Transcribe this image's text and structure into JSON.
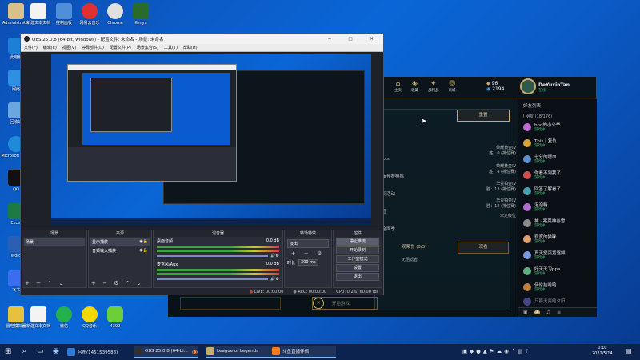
{
  "desktop": {
    "icons_left": [
      {
        "label": "Administrator",
        "color": "#d9c08a"
      },
      {
        "label": "此电脑",
        "color": "#1d7fd6"
      },
      {
        "label": "网络",
        "color": "#2f8fe0"
      },
      {
        "label": "回收站",
        "color": "#6aa6e0"
      },
      {
        "label": "Microsoft Edge",
        "color": "#1e8ad8"
      },
      {
        "label": "QQ",
        "color": "#111111"
      },
      {
        "label": "Excel",
        "color": "#1e7a45"
      },
      {
        "label": "Word",
        "color": "#2a5fb4"
      },
      {
        "label": "飞书",
        "color": "#3a6df0"
      },
      {
        "label": "雷电模拟器",
        "color": "#e8c040"
      }
    ],
    "icons_top": [
      {
        "label": "新建文本文档",
        "color": "#f3f3f3"
      },
      {
        "label": "控制面板",
        "color": "#4f8ed8"
      },
      {
        "label": "网易云音乐",
        "color": "#e03030"
      },
      {
        "label": "Chrome",
        "color": "#e0e0e0"
      },
      {
        "label": "Kenya",
        "color": "#2a6a2a"
      }
    ],
    "icons_bottom": [
      {
        "label": "新建文本文档",
        "color": "#f3f3f3"
      },
      {
        "label": "微信",
        "color": "#23b14d"
      },
      {
        "label": "QQ音乐",
        "color": "#f5d800"
      },
      {
        "label": "4399",
        "color": "#6ccf3a"
      }
    ]
  },
  "taskbar": {
    "apps": [
      {
        "label": "吕布(1451539583)",
        "color": "#2f7bd8"
      },
      {
        "label": "OBS 25.0.8 (64-bi...",
        "color": "#303030"
      },
      {
        "label": "League of Legends",
        "color": "#c8aa6e"
      },
      {
        "label": "斗鱼直播伴侣",
        "color": "#f57a1a"
      }
    ],
    "time": "0:10",
    "date": "2022/5/14"
  },
  "obs": {
    "title": "OBS 25.0.8 (64-bit, windows) - 配置文件: 未命名 - 场景: 未命名",
    "menu": [
      "文件(F)",
      "编辑(E)",
      "视图(V)",
      "停靠部件(D)",
      "配置文件(P)",
      "场景集合(S)",
      "工具(T)",
      "帮助(H)"
    ],
    "docks": {
      "scenes": "场景",
      "sources": "来源",
      "mixer": "混音器",
      "transitions": "转场特效",
      "controls": "控件"
    },
    "scene_item": "场景",
    "sources": [
      "显示捕获",
      "音频输入捕获"
    ],
    "mixer": [
      {
        "name": "桌面音频",
        "db": "0.0 dB"
      },
      {
        "name": "麦克风/Aux",
        "db": "0.0 dB"
      }
    ],
    "transition": {
      "type": "淡出",
      "duration_label": "时长",
      "duration": "300 ms"
    },
    "controls": [
      "停止推流",
      "开始录制",
      "工作室模式",
      "设置",
      "退出"
    ],
    "status": {
      "live": "LIVE: 00:00:00",
      "rec": "REC: 00:00:00",
      "cpu": "CPU: 0.2%, 60.00 fps"
    }
  },
  "lol": {
    "nav": [
      "主页",
      "收藏",
      "战利品",
      "商城"
    ],
    "be": "96",
    "rp": "2194",
    "username": "DeYuxinTan",
    "status": "在线",
    "friends_header": "好友列表",
    "group": "Ⅰ 朋友 (18/176)",
    "friends": [
      {
        "name": "bno的小公举",
        "status": "游戏中",
        "color": "#c26bd3"
      },
      {
        "name": "This丨复仇",
        "status": "游戏中",
        "color": "#d7a43a"
      },
      {
        "name": "七分的嗜血",
        "status": "游戏中",
        "color": "#5d8fd1"
      },
      {
        "name": "你看不到我了",
        "status": "游戏中",
        "color": "#d05050"
      },
      {
        "name": "回答了解看了",
        "status": "游戏中",
        "color": "#4aa0b0"
      },
      {
        "name": "泡泡糖",
        "status": "游戏中",
        "color": "#b070d0"
      },
      {
        "name": "神 · 案荚神谷雪",
        "status": "游戏中",
        "color": "#8c8c8c"
      },
      {
        "name": "寂寞的猫咪",
        "status": "游戏中",
        "color": "#e0a070"
      },
      {
        "name": "真天堂突竞驱鲜",
        "status": "游戏中",
        "color": "#7a9adf"
      },
      {
        "name": "好天天习ppa",
        "status": "游戏中",
        "color": "#60b080"
      },
      {
        "name": "伊伦挂哈哈",
        "status": "游戏中",
        "color": "#c08040"
      },
      {
        "name": "只影无穷绝夕阳",
        "status": "游戏中",
        "color": "#6a6ad0"
      }
    ],
    "ranks": [
      {
        "tier": "荣耀黄金IV",
        "wins": "胜：0 (排位赛)"
      },
      {
        "tier": "荣耀黄金IV",
        "wins": "胜：4 (排位赛)"
      },
      {
        "tier": "华贵铂金IV",
        "wins": "胜：13 (排位赛)"
      },
      {
        "tier": "华贵铂金IV",
        "wins": "胜：12 (排位赛)"
      },
      {
        "tier": "未定级位",
        "wins": ""
      }
    ],
    "left_labels": [
      "Loots",
      "子审预赛模拟",
      "订阅活动",
      "峰值",
      "大全面季"
    ],
    "honor": "观荣誉 (0/5)",
    "honor_sub": "无阻滤者",
    "button_confirm": "重置",
    "button_right": "观看",
    "play_button": "开始游戏",
    "chat_count": "3"
  }
}
